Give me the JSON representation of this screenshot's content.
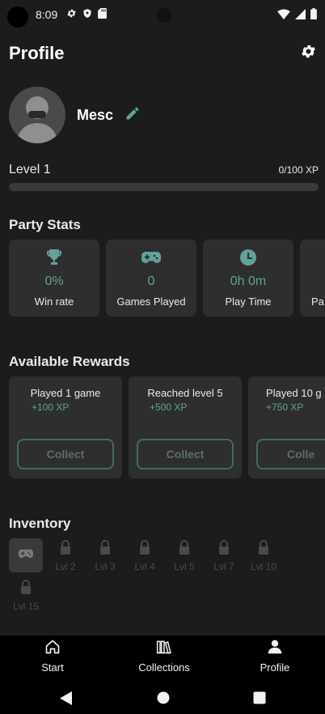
{
  "status_bar": {
    "time": "8:09"
  },
  "header": {
    "title": "Profile"
  },
  "profile": {
    "username": "Mesc"
  },
  "level": {
    "label": "Level 1",
    "xp_text": "0/100 XP",
    "progress": 0
  },
  "party_stats": {
    "title": "Party Stats",
    "cards": [
      {
        "icon": "trophy-icon",
        "value": "0%",
        "label": "Win rate"
      },
      {
        "icon": "gamepad-icon",
        "value": "0",
        "label": "Games Played"
      },
      {
        "icon": "clock-icon",
        "value": "0h 0m",
        "label": "Play Time"
      },
      {
        "icon": "",
        "value": "",
        "label": "Pa"
      }
    ]
  },
  "rewards": {
    "title": "Available Rewards",
    "cards": [
      {
        "title": "Played 1 game",
        "xp": "+100 XP",
        "button": "Collect"
      },
      {
        "title": "Reached level 5",
        "xp": "+500 XP",
        "button": "Collect"
      },
      {
        "title": "Played 10 g",
        "xp": "+750 XP",
        "button": "Colle"
      }
    ]
  },
  "inventory": {
    "title": "Inventory",
    "locked_items": [
      "Lvl 2",
      "Lvl 3",
      "Lvl 4",
      "Lvl 5",
      "Lvl 7",
      "Lvl 10",
      "Lvl 15"
    ]
  },
  "bottom_nav": {
    "items": [
      {
        "label": "Start",
        "icon": "home-icon"
      },
      {
        "label": "Collections",
        "icon": "books-icon"
      },
      {
        "label": "Profile",
        "icon": "person-icon"
      }
    ]
  },
  "colors": {
    "accent": "#5fa39a",
    "background": "#1c1c1c",
    "card": "#2e2e2e"
  }
}
